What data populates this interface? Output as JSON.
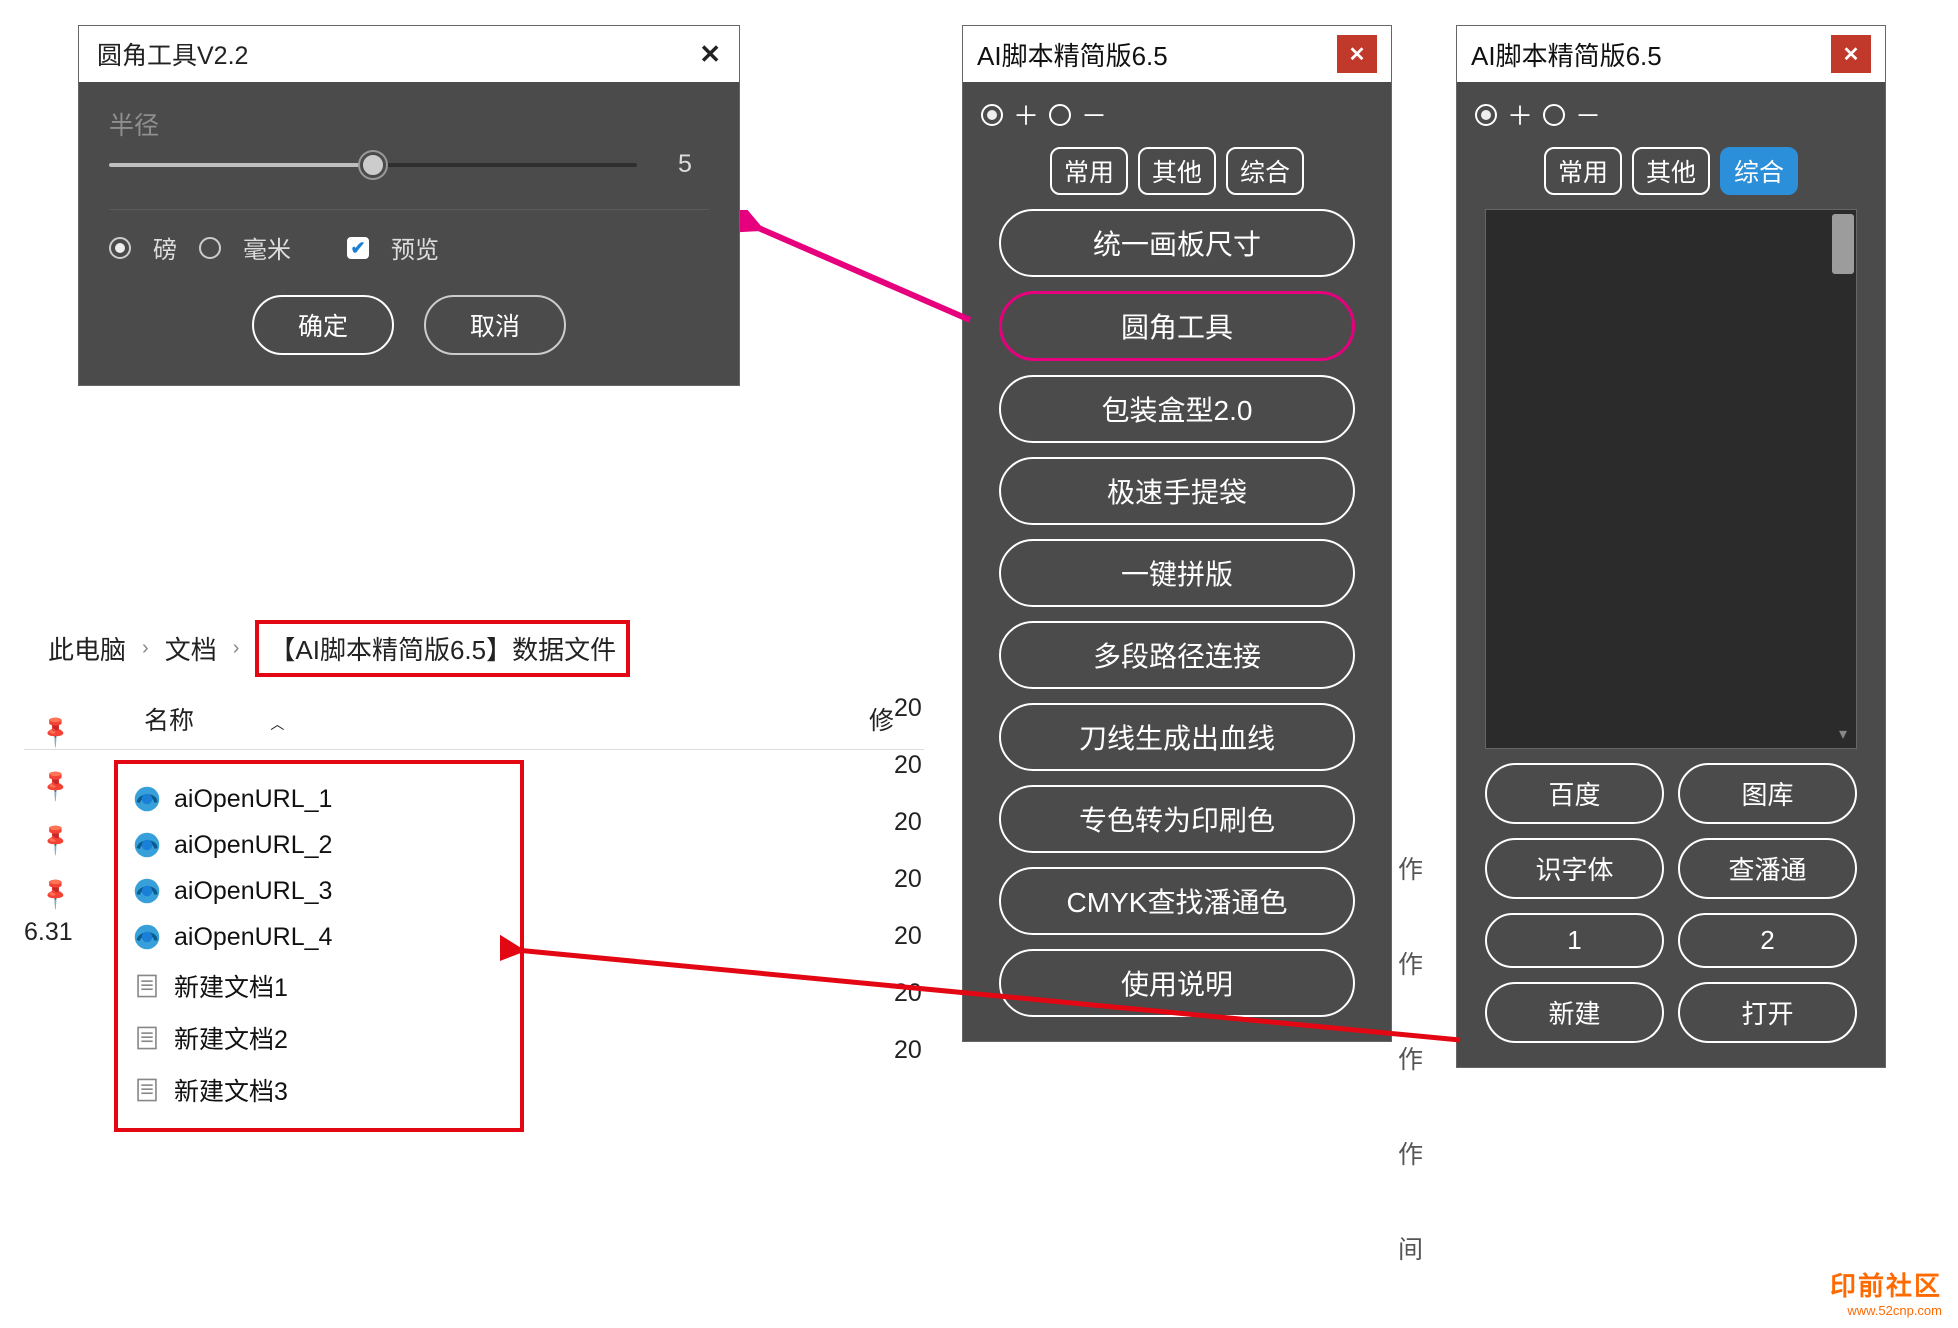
{
  "dialog": {
    "title": "圆角工具V2.2",
    "radius_label": "半径",
    "radius_value": "5",
    "unit_pound": "磅",
    "unit_mm": "毫米",
    "preview_label": "预览",
    "ok": "确定",
    "cancel": "取消"
  },
  "explorer": {
    "crumb_pc": "此电脑",
    "crumb_docs": "文档",
    "crumb_folder": "【AI脚本精简版6.5】数据文件",
    "col_name": "名称",
    "col_modified": "修",
    "version_fragment": "6.31",
    "files": [
      {
        "name": "aiOpenURL_1",
        "icon": "edge",
        "date": "20"
      },
      {
        "name": "aiOpenURL_2",
        "icon": "edge",
        "date": "20"
      },
      {
        "name": "aiOpenURL_3",
        "icon": "edge",
        "date": "20"
      },
      {
        "name": "aiOpenURL_4",
        "icon": "edge",
        "date": "20"
      },
      {
        "name": "新建文档1",
        "icon": "txt",
        "date": "20"
      },
      {
        "name": "新建文档2",
        "icon": "txt",
        "date": "20"
      },
      {
        "name": "新建文档3",
        "icon": "txt",
        "date": "20"
      }
    ]
  },
  "panel_left": {
    "title": "AI脚本精简版6.5",
    "plus": "＋",
    "minus": "－",
    "tabs": [
      "常用",
      "其他",
      "综合"
    ],
    "active_tab": 0,
    "tools": [
      "统一画板尺寸",
      "圆角工具",
      "包装盒型2.0",
      "极速手提袋",
      "一键拼版",
      "多段路径连接",
      "刀线生成出血线",
      "专色转为印刷色",
      "CMYK查找潘通色",
      "使用说明"
    ],
    "highlighted_tool_index": 1,
    "side_chars": [
      "作",
      "作",
      "作",
      "作",
      "间"
    ]
  },
  "panel_right": {
    "title": "AI脚本精简版6.5",
    "plus": "＋",
    "minus": "－",
    "tabs": [
      "常用",
      "其他",
      "综合"
    ],
    "active_tab": 2,
    "grid": [
      "百度",
      "图库",
      "识字体",
      "查潘通",
      "1",
      "2",
      "新建",
      "打开"
    ]
  },
  "watermark": {
    "line1": "印前社区",
    "line2": "www.52cnp.com"
  }
}
